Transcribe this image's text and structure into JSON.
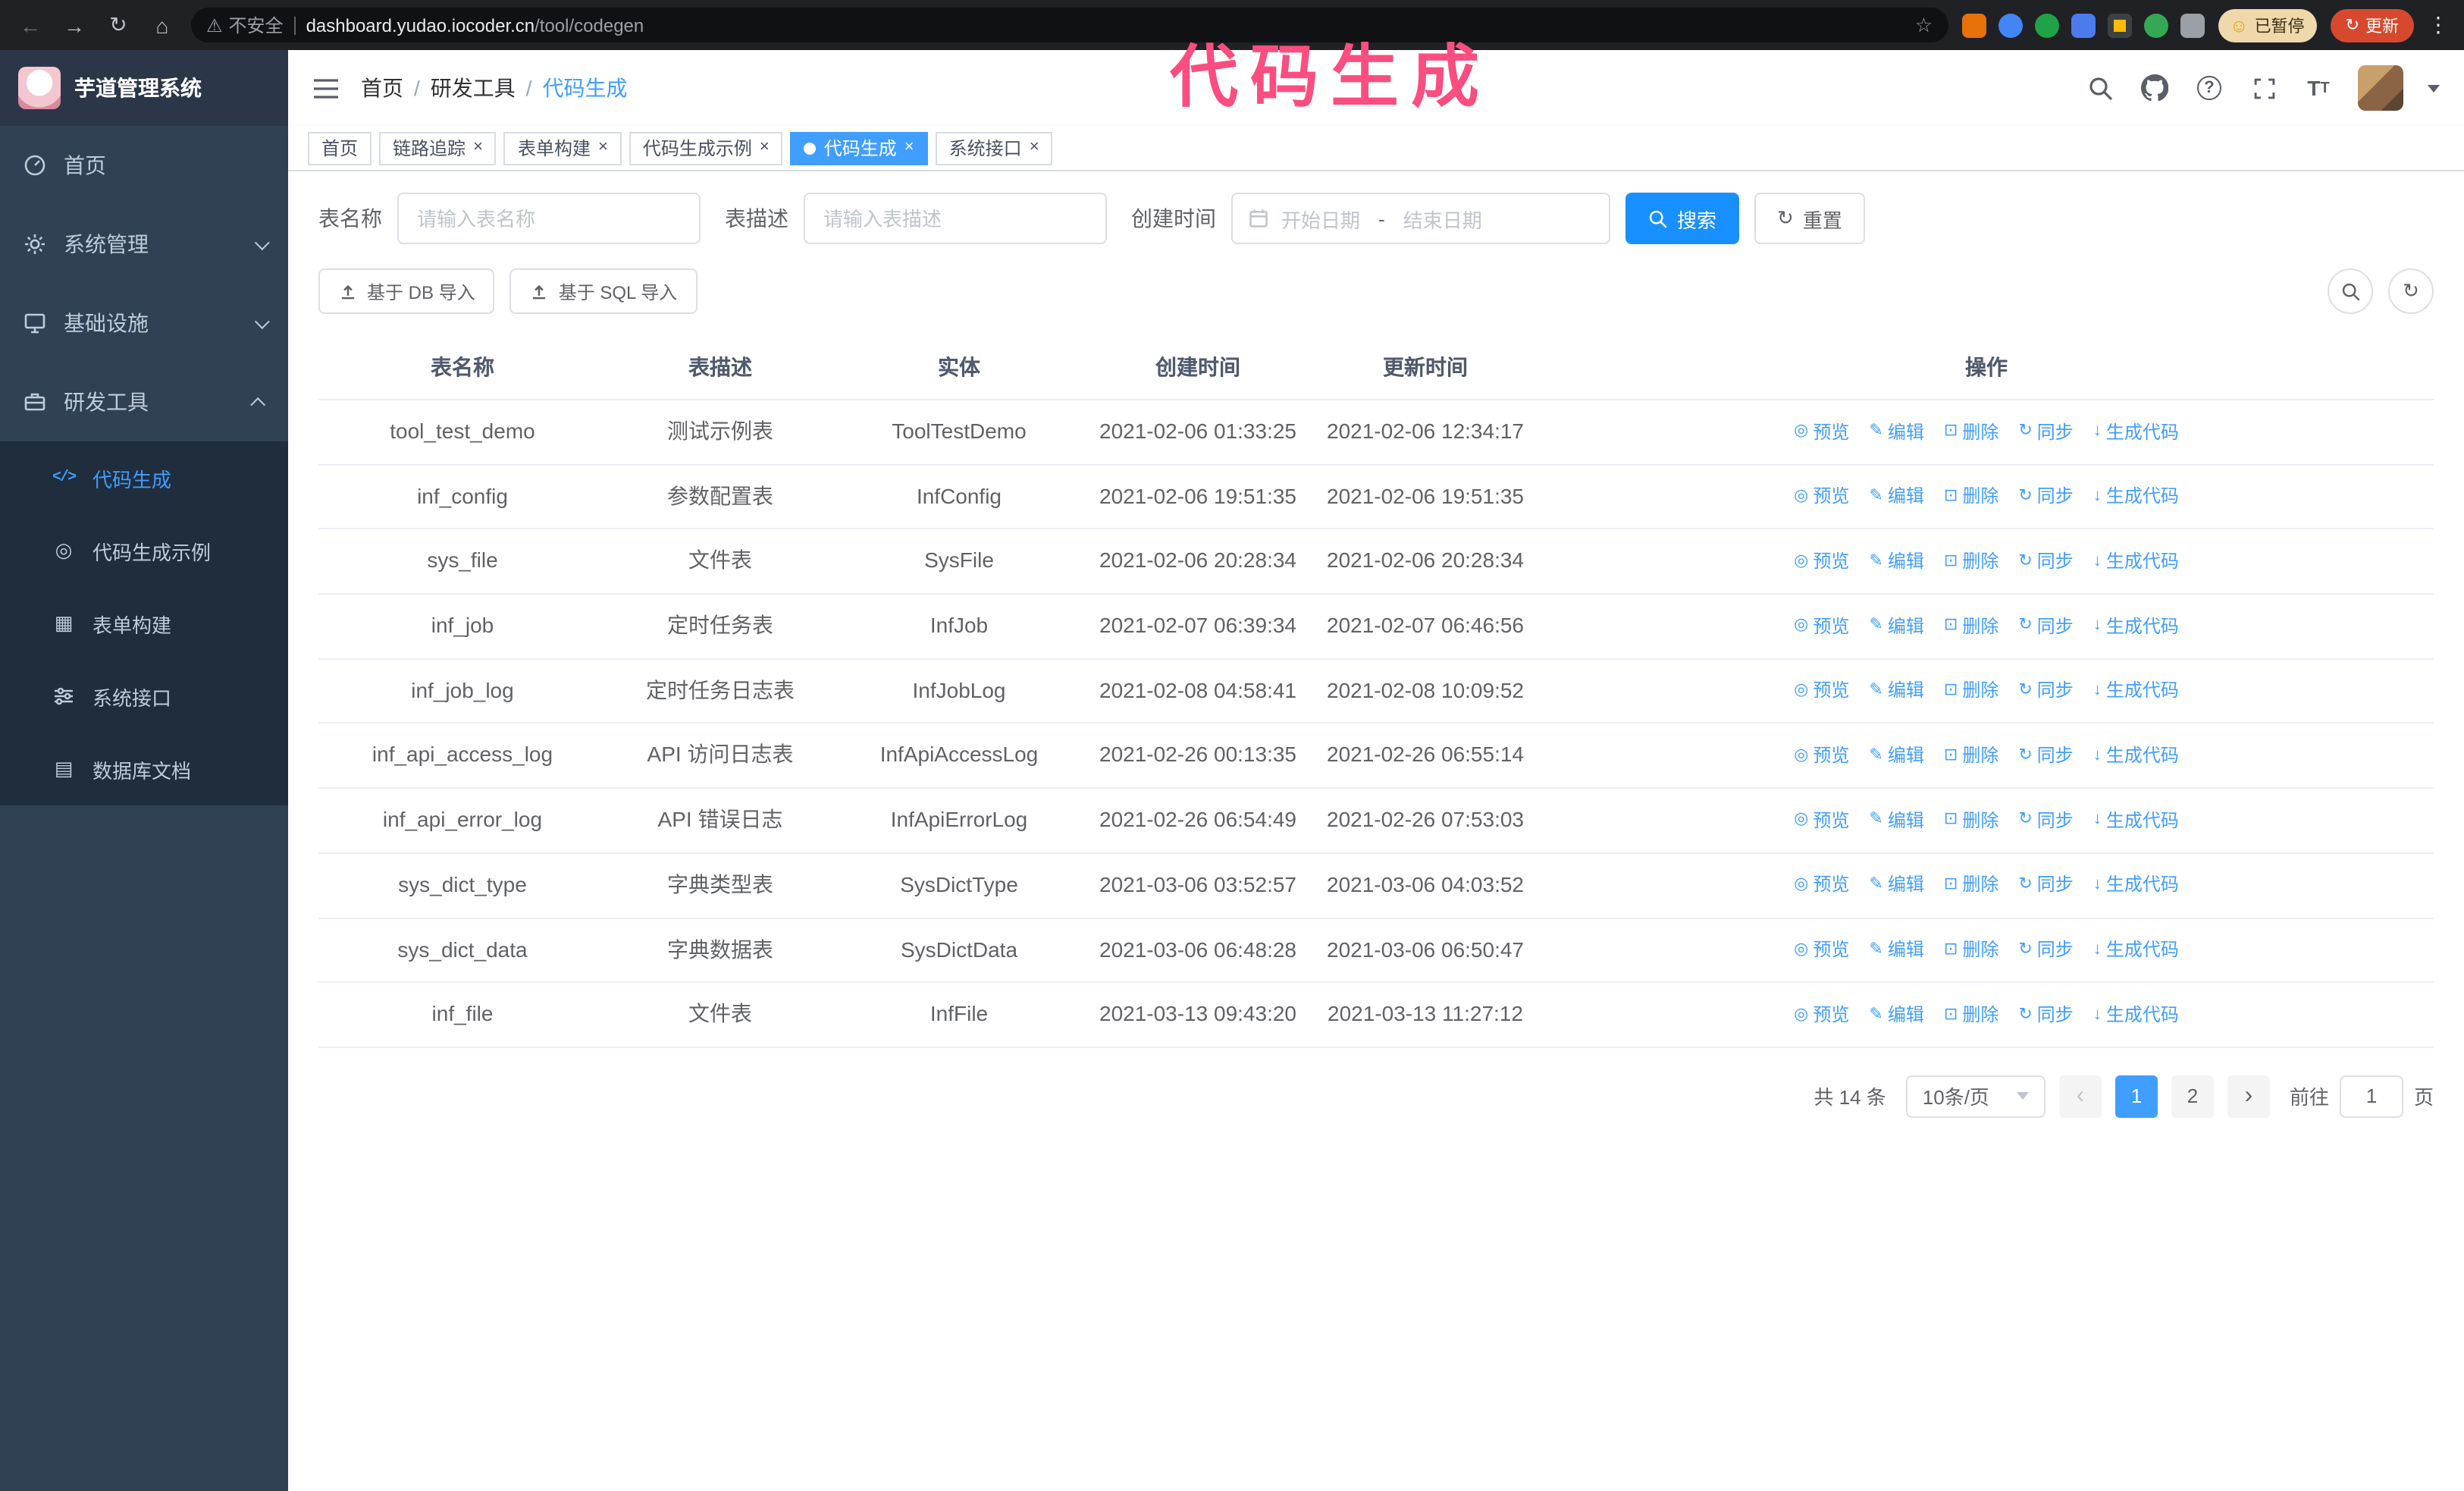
{
  "annotation": {
    "text": "代码生成",
    "color": "#fb4d80"
  },
  "colors": {
    "accent": "#409eff",
    "primary_button": "#1890ff",
    "sidebar_bg": "#304156",
    "submenu_bg": "#1f2d3d",
    "active_tab": "#409eff",
    "update_button": "#d6492f",
    "annotation_pink": "#fb4d80"
  },
  "browser": {
    "security_label": "不安全",
    "url_host": "dashboard.yudao.iocoder.cn",
    "url_path": "/tool/codegen",
    "paused_badge": "已暂停",
    "update_button": "更新"
  },
  "sidebar": {
    "title": "芋道管理系统",
    "items": [
      {
        "label": "首页",
        "icon": "dashboard-icon"
      },
      {
        "label": "系统管理",
        "icon": "gear-icon",
        "expandable": true
      },
      {
        "label": "基础设施",
        "icon": "infra-icon",
        "expandable": true
      },
      {
        "label": "研发工具",
        "icon": "tools-icon",
        "expandable": true,
        "expanded": true,
        "children": [
          {
            "label": "代码生成",
            "icon": "code-icon",
            "active": true
          },
          {
            "label": "代码生成示例",
            "icon": "example-icon"
          },
          {
            "label": "表单构建",
            "icon": "form-icon"
          },
          {
            "label": "系统接口",
            "icon": "api-icon"
          },
          {
            "label": "数据库文档",
            "icon": "db-doc-icon"
          }
        ]
      }
    ]
  },
  "header": {
    "breadcrumb": [
      "首页",
      "研发工具",
      "代码生成"
    ]
  },
  "tabs": [
    {
      "label": "首页",
      "closable": false
    },
    {
      "label": "链路追踪",
      "closable": true
    },
    {
      "label": "表单构建",
      "closable": true
    },
    {
      "label": "代码生成示例",
      "closable": true
    },
    {
      "label": "代码生成",
      "closable": true,
      "active": true
    },
    {
      "label": "系统接口",
      "closable": true
    }
  ],
  "filters": {
    "name_label": "表名称",
    "name_placeholder": "请输入表名称",
    "desc_label": "表描述",
    "desc_placeholder": "请输入表描述",
    "time_label": "创建时间",
    "start_placeholder": "开始日期",
    "range_separator": "-",
    "end_placeholder": "结束日期",
    "search_label": "搜索",
    "reset_label": "重置"
  },
  "toolbar": {
    "import_db": "基于 DB 导入",
    "import_sql": "基于 SQL 导入"
  },
  "table": {
    "columns": [
      "表名称",
      "表描述",
      "实体",
      "创建时间",
      "更新时间",
      "操作"
    ],
    "action_labels": [
      "预览",
      "编辑",
      "删除",
      "同步",
      "生成代码"
    ],
    "action_icons": [
      "eye-icon",
      "pencil-icon",
      "trash-icon",
      "sync-icon",
      "download-icon"
    ],
    "rows": [
      {
        "name": "tool_test_demo",
        "desc": "测试示例表",
        "entity": "ToolTestDemo",
        "created": "2021-02-06 01:33:25",
        "updated": "2021-02-06 12:34:17"
      },
      {
        "name": "inf_config",
        "desc": "参数配置表",
        "entity": "InfConfig",
        "created": "2021-02-06 19:51:35",
        "updated": "2021-02-06 19:51:35"
      },
      {
        "name": "sys_file",
        "desc": "文件表",
        "entity": "SysFile",
        "created": "2021-02-06 20:28:34",
        "updated": "2021-02-06 20:28:34"
      },
      {
        "name": "inf_job",
        "desc": "定时任务表",
        "entity": "InfJob",
        "created": "2021-02-07 06:39:34",
        "updated": "2021-02-07 06:46:56"
      },
      {
        "name": "inf_job_log",
        "desc": "定时任务日志表",
        "entity": "InfJobLog",
        "created": "2021-02-08 04:58:41",
        "updated": "2021-02-08 10:09:52"
      },
      {
        "name": "inf_api_access_log",
        "desc": "API 访问日志表",
        "entity": "InfApiAccessLog",
        "created": "2021-02-26 00:13:35",
        "updated": "2021-02-26 06:55:14"
      },
      {
        "name": "inf_api_error_log",
        "desc": "API 错误日志",
        "entity": "InfApiErrorLog",
        "created": "2021-02-26 06:54:49",
        "updated": "2021-02-26 07:53:03"
      },
      {
        "name": "sys_dict_type",
        "desc": "字典类型表",
        "entity": "SysDictType",
        "created": "2021-03-06 03:52:57",
        "updated": "2021-03-06 04:03:52"
      },
      {
        "name": "sys_dict_data",
        "desc": "字典数据表",
        "entity": "SysDictData",
        "created": "2021-03-06 06:48:28",
        "updated": "2021-03-06 06:50:47"
      },
      {
        "name": "inf_file",
        "desc": "文件表",
        "entity": "InfFile",
        "created": "2021-03-13 09:43:20",
        "updated": "2021-03-13 11:27:12"
      }
    ]
  },
  "pagination": {
    "total": "共 14 条",
    "page_size": "10条/页",
    "pages": [
      "1",
      "2"
    ],
    "active_page": "1",
    "goto_label": "前往",
    "goto_value": "1",
    "page_suffix": "页"
  }
}
